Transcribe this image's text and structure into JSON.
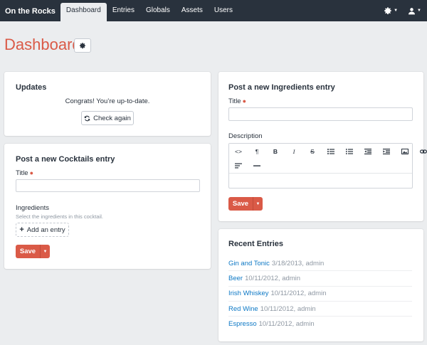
{
  "site_name": "On the Rocks",
  "nav": {
    "items": [
      "Dashboard",
      "Entries",
      "Globals",
      "Assets",
      "Users"
    ],
    "active": "Dashboard"
  },
  "page": {
    "title": "Dashboard"
  },
  "updates": {
    "heading": "Updates",
    "message": "Congrats! You’re up-to-date.",
    "check_label": "Check again"
  },
  "cocktails": {
    "heading": "Post a new Cocktails entry",
    "title_label": "Title",
    "ingredients_label": "Ingredients",
    "ingredients_hint": "Select the ingredients in this cocktail.",
    "add_entry_label": "Add an entry",
    "save_label": "Save"
  },
  "ingredients_entry": {
    "heading": "Post a new Ingredients entry",
    "title_label": "Title",
    "description_label": "Description",
    "toolbar": [
      "<>",
      "¶",
      "B",
      "I",
      "S",
      "•≡",
      "1≡",
      "⇤",
      "⇥",
      "img",
      "link",
      "align",
      "hr"
    ],
    "save_label": "Save"
  },
  "recent": {
    "heading": "Recent Entries",
    "entries": [
      {
        "title": "Gin and Tonic",
        "meta": "3/18/2013, admin"
      },
      {
        "title": "Beer",
        "meta": "10/11/2012, admin"
      },
      {
        "title": "Irish Whiskey",
        "meta": "10/11/2012, admin"
      },
      {
        "title": "Red Wine",
        "meta": "10/11/2012, admin"
      },
      {
        "title": "Espresso",
        "meta": "10/11/2012, admin"
      }
    ]
  },
  "colors": {
    "accent": "#da5a47",
    "link": "#0d78c5",
    "nav_bg": "#29323d",
    "page_bg": "#ebedef"
  },
  "icons": {
    "settings": "gear-icon",
    "user": "user-icon",
    "refresh": "refresh-icon",
    "add": "plus-icon"
  }
}
